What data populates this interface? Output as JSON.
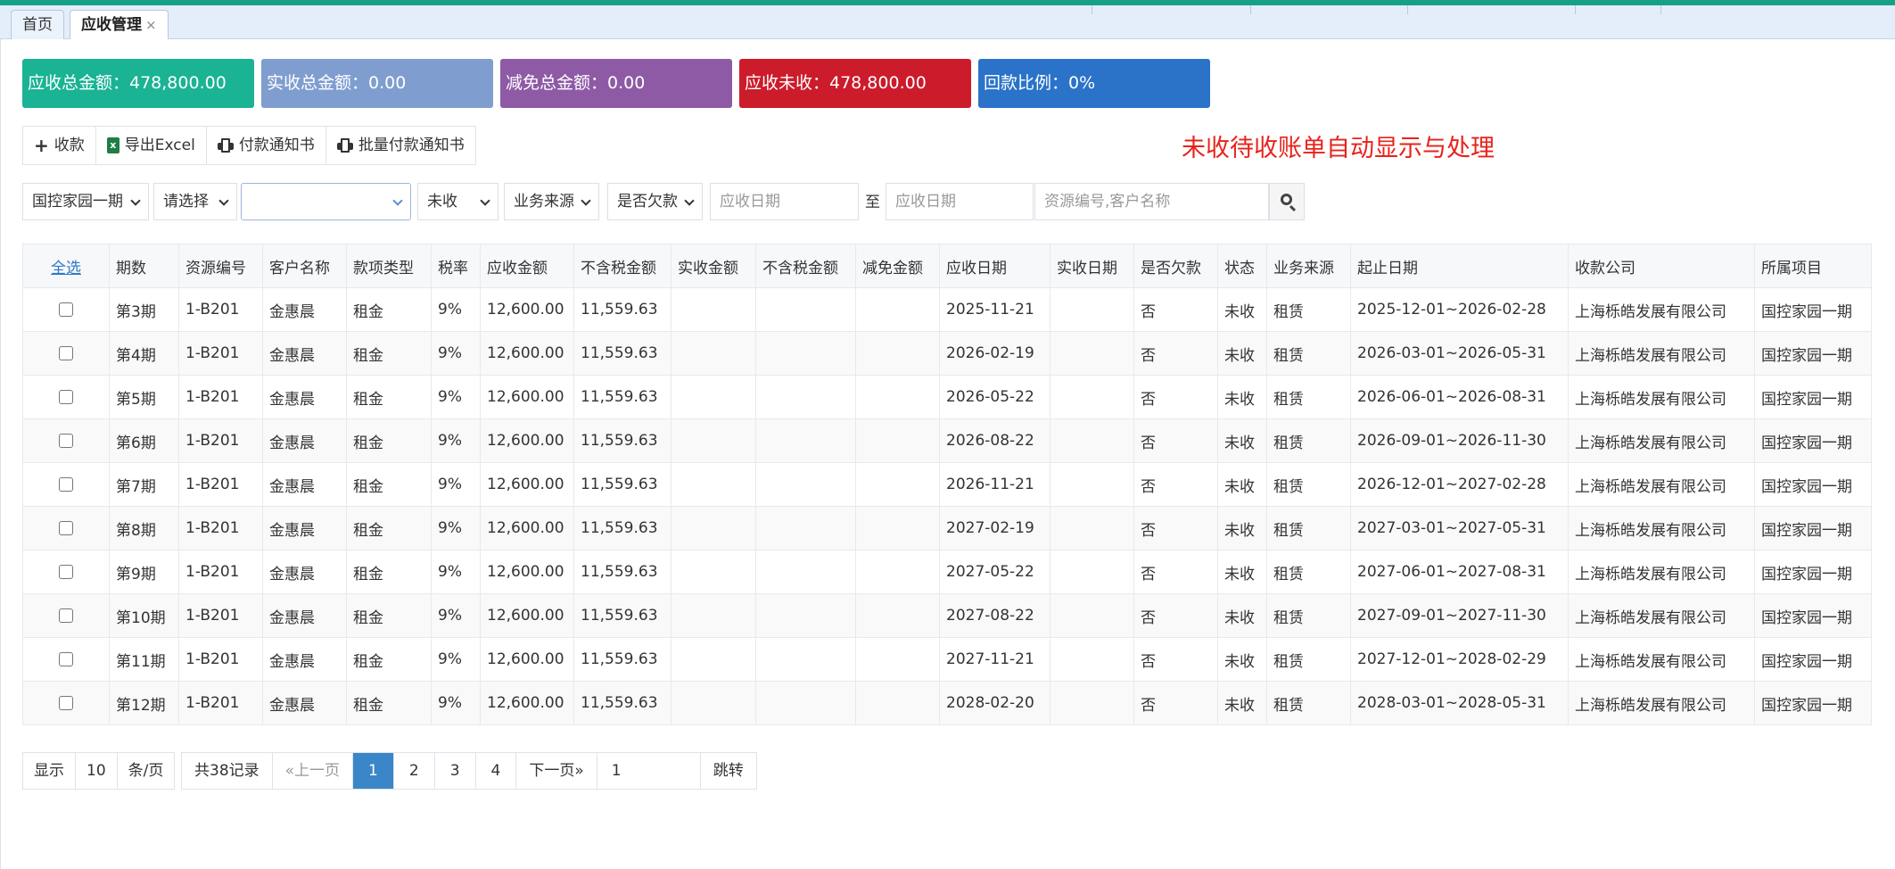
{
  "tabs": [
    {
      "label": "首页"
    },
    {
      "label": "应收管理",
      "close": "×"
    }
  ],
  "stats": [
    {
      "label": "应收总金额：478,800.00",
      "color": "#1ab394"
    },
    {
      "label": "实收总金额：0.00",
      "color": "#7f9ecf"
    },
    {
      "label": "减免总金额：0.00",
      "color": "#8e5aa5"
    },
    {
      "label": "应收未收：478,800.00",
      "color": "#cc1b2b"
    },
    {
      "label": "回款比例：0%",
      "color": "#2a73c9"
    }
  ],
  "toolbar": {
    "collect": "收款",
    "export": "导出Excel",
    "notice": "付款通知书",
    "batch_notice": "批量付款通知书"
  },
  "banner": "未收待收账单自动显示与处理",
  "filters": {
    "project": "国控家园一期",
    "choose": "请选择",
    "combo": "",
    "status": "未收",
    "source": "业务来源",
    "arrears": "是否欠款",
    "date_from_ph": "应收日期",
    "to": "至",
    "date_to_ph": "应收日期",
    "keyword_ph": "资源编号,客户名称"
  },
  "table": {
    "select_all": "全选",
    "headers": [
      "期数",
      "资源编号",
      "客户名称",
      "款项类型",
      "税率",
      "应收金额",
      "不含税金额",
      "实收金额",
      "不含税金额",
      "减免金额",
      "应收日期",
      "实收日期",
      "是否欠款",
      "状态",
      "业务来源",
      "起止日期",
      "收款公司",
      "所属项目"
    ],
    "rows": [
      [
        "第3期",
        "1-B201",
        "金惠晨",
        "租金",
        "9%",
        "12,600.00",
        "11,559.63",
        "",
        "",
        "",
        "2025-11-21",
        "",
        "否",
        "未收",
        "租赁",
        "2025-12-01~2026-02-28",
        "上海栎皓发展有限公司",
        "国控家园一期"
      ],
      [
        "第4期",
        "1-B201",
        "金惠晨",
        "租金",
        "9%",
        "12,600.00",
        "11,559.63",
        "",
        "",
        "",
        "2026-02-19",
        "",
        "否",
        "未收",
        "租赁",
        "2026-03-01~2026-05-31",
        "上海栎皓发展有限公司",
        "国控家园一期"
      ],
      [
        "第5期",
        "1-B201",
        "金惠晨",
        "租金",
        "9%",
        "12,600.00",
        "11,559.63",
        "",
        "",
        "",
        "2026-05-22",
        "",
        "否",
        "未收",
        "租赁",
        "2026-06-01~2026-08-31",
        "上海栎皓发展有限公司",
        "国控家园一期"
      ],
      [
        "第6期",
        "1-B201",
        "金惠晨",
        "租金",
        "9%",
        "12,600.00",
        "11,559.63",
        "",
        "",
        "",
        "2026-08-22",
        "",
        "否",
        "未收",
        "租赁",
        "2026-09-01~2026-11-30",
        "上海栎皓发展有限公司",
        "国控家园一期"
      ],
      [
        "第7期",
        "1-B201",
        "金惠晨",
        "租金",
        "9%",
        "12,600.00",
        "11,559.63",
        "",
        "",
        "",
        "2026-11-21",
        "",
        "否",
        "未收",
        "租赁",
        "2026-12-01~2027-02-28",
        "上海栎皓发展有限公司",
        "国控家园一期"
      ],
      [
        "第8期",
        "1-B201",
        "金惠晨",
        "租金",
        "9%",
        "12,600.00",
        "11,559.63",
        "",
        "",
        "",
        "2027-02-19",
        "",
        "否",
        "未收",
        "租赁",
        "2027-03-01~2027-05-31",
        "上海栎皓发展有限公司",
        "国控家园一期"
      ],
      [
        "第9期",
        "1-B201",
        "金惠晨",
        "租金",
        "9%",
        "12,600.00",
        "11,559.63",
        "",
        "",
        "",
        "2027-05-22",
        "",
        "否",
        "未收",
        "租赁",
        "2027-06-01~2027-08-31",
        "上海栎皓发展有限公司",
        "国控家园一期"
      ],
      [
        "第10期",
        "1-B201",
        "金惠晨",
        "租金",
        "9%",
        "12,600.00",
        "11,559.63",
        "",
        "",
        "",
        "2027-08-22",
        "",
        "否",
        "未收",
        "租赁",
        "2027-09-01~2027-11-30",
        "上海栎皓发展有限公司",
        "国控家园一期"
      ],
      [
        "第11期",
        "1-B201",
        "金惠晨",
        "租金",
        "9%",
        "12,600.00",
        "11,559.63",
        "",
        "",
        "",
        "2027-11-21",
        "",
        "否",
        "未收",
        "租赁",
        "2027-12-01~2028-02-29",
        "上海栎皓发展有限公司",
        "国控家园一期"
      ],
      [
        "第12期",
        "1-B201",
        "金惠晨",
        "租金",
        "9%",
        "12,600.00",
        "11,559.63",
        "",
        "",
        "",
        "2028-02-20",
        "",
        "否",
        "未收",
        "租赁",
        "2028-03-01~2028-05-31",
        "上海栎皓发展有限公司",
        "国控家园一期"
      ]
    ]
  },
  "pager": {
    "show": "显示",
    "page_size": "10",
    "per_page": "条/页",
    "total": "共38记录",
    "prev": "«上一页",
    "pages": [
      "1",
      "2",
      "3",
      "4"
    ],
    "current": "1",
    "next": "下一页»",
    "jump_value": "1",
    "jump": "跳转"
  }
}
